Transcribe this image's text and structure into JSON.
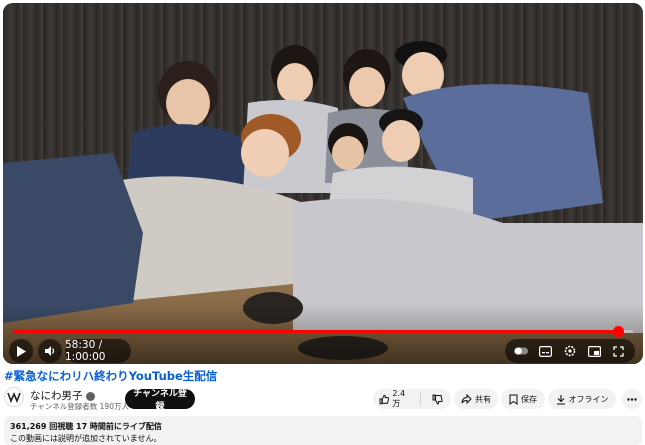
{
  "player": {
    "time_display": "58:30 / 1:00:00",
    "progress_fraction": 0.975
  },
  "video": {
    "title": "#緊急なにわリハ終わりYouTube生配信"
  },
  "channel": {
    "name": "なにわ男子",
    "subscribers": "チャンネル登録者数 190万人",
    "subscribe_label": "チャンネル登録"
  },
  "actions": {
    "likes": "2.4万",
    "share": "共有",
    "save": "保存",
    "offline": "オフライン"
  },
  "description": {
    "stats": "361,269 回視聴  17 時間前にライブ配信",
    "text": "この動画には説明が追加されていません。"
  },
  "colors": {
    "progress": "#ff0000",
    "title_link": "#065fd4"
  }
}
